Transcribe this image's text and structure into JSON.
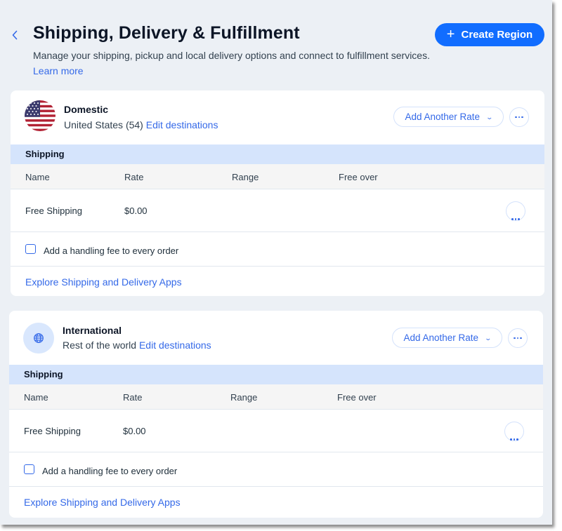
{
  "header": {
    "back_icon": "chevron-left-icon",
    "title": "Shipping, Delivery & Fulfillment",
    "description": "Manage your shipping, pickup and local delivery options and connect to fulfillment services.",
    "learn_more": "Learn more",
    "create_region": {
      "icon": "plus-icon",
      "label": "Create Region"
    }
  },
  "colors": {
    "accent": "#116dff",
    "link": "#3469e8",
    "page_background": "#ecf0f5",
    "section_bar": "#d5e4fc"
  },
  "regions": [
    {
      "name": "Domestic",
      "icon": "us-flag-icon",
      "destinations": "United States (54)",
      "edit_destinations": "Edit destinations",
      "add_rate_label": "Add Another Rate",
      "section_title": "Shipping",
      "columns": [
        "Name",
        "Rate",
        "Range",
        "Free over"
      ],
      "rates": [
        {
          "name": "Free Shipping",
          "rate": "$0.00",
          "range": "",
          "free_over": ""
        }
      ],
      "handling_fee": {
        "label": "Add a handling fee to every order",
        "checked": false
      },
      "apps_link": "Explore Shipping and Delivery Apps"
    },
    {
      "name": "International",
      "icon": "globe-icon",
      "destinations": "Rest of the world",
      "edit_destinations": "Edit destinations",
      "add_rate_label": "Add Another Rate",
      "section_title": "Shipping",
      "columns": [
        "Name",
        "Rate",
        "Range",
        "Free over"
      ],
      "rates": [
        {
          "name": "Free Shipping",
          "rate": "$0.00",
          "range": "",
          "free_over": ""
        }
      ],
      "handling_fee": {
        "label": "Add a handling fee to every order",
        "checked": false
      },
      "apps_link": "Explore Shipping and Delivery Apps"
    }
  ]
}
